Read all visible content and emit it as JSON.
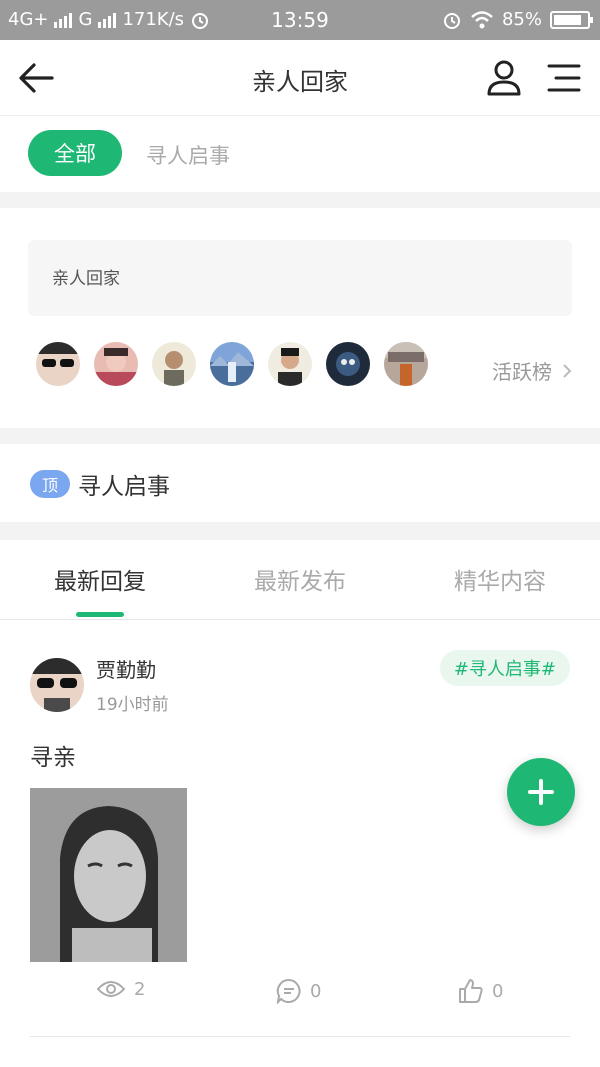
{
  "status_bar": {
    "network1": "4G+",
    "network2": "G",
    "speed": "171K/s",
    "time": "13:59",
    "battery": "85%",
    "battery_level": 0.85
  },
  "header": {
    "back_icon": "arrow-left-icon",
    "title": "亲人回家",
    "user_icon": "user-icon",
    "menu_icon": "menu-icon"
  },
  "filters": {
    "items": [
      {
        "label": "全部"
      },
      {
        "label": "寻人启事"
      }
    ]
  },
  "community": {
    "description": "亲人回家",
    "rank_label": "活跃榜",
    "avatar_colors": [
      "#2c2c2c",
      "#b94a5b",
      "#cfc6a7",
      "#5a7fbf",
      "#f0ece2",
      "#1f2b3a",
      "#7a6d6a"
    ]
  },
  "pinned": {
    "badge": "顶",
    "title": "寻人启事"
  },
  "tabs": {
    "items": [
      {
        "label": "最新回复"
      },
      {
        "label": "最新发布"
      },
      {
        "label": "精华内容"
      }
    ]
  },
  "post": {
    "author": "贾勤勤",
    "time": "19小时前",
    "tag": "#寻人启事#",
    "title": "寻亲",
    "views": "2",
    "comments": "0",
    "likes": "0"
  },
  "colors": {
    "accent": "#1fb774",
    "pin_badge": "#7aa7ef",
    "status_bar": "#9b9b9b"
  }
}
